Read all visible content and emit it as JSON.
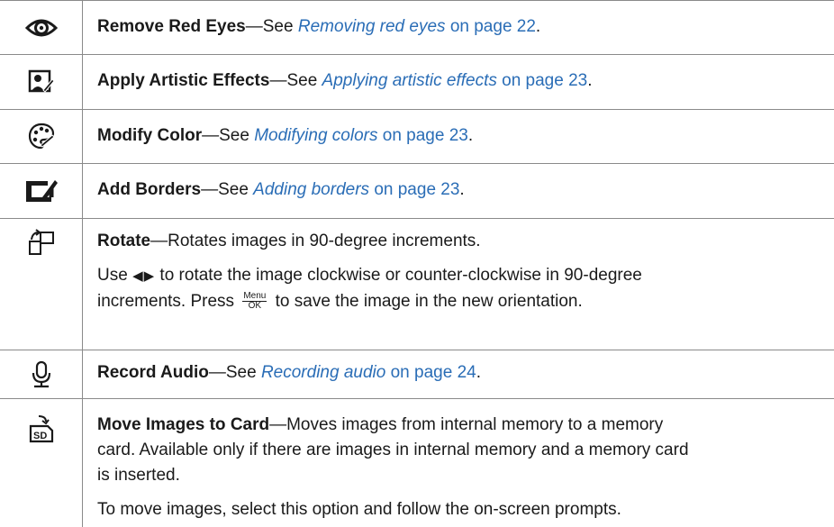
{
  "rows": [
    {
      "icon": "eye-icon",
      "title": "Remove Red Eyes",
      "dash": "—See ",
      "link": "Removing red eyes",
      "on": " on page 22",
      "end": "."
    },
    {
      "icon": "artistic-effects-icon",
      "title": "Apply Artistic Effects",
      "dash": "—See ",
      "link": "Applying artistic effects",
      "on": " on page 23",
      "end": "."
    },
    {
      "icon": "palette-icon",
      "title": "Modify Color",
      "dash": "—See ",
      "link": "Modifying colors",
      "on": " on page 23",
      "end": "."
    },
    {
      "icon": "border-icon",
      "title": "Add Borders",
      "dash": "—See ",
      "link": "Adding borders",
      "on": " on page 23",
      "end": "."
    },
    {
      "icon": "rotate-icon",
      "title": "Rotate",
      "desc": "—Rotates images in 90-degree increments.",
      "p2a": "Use ",
      "p2arrows": "◀▶",
      "p2b": " to rotate the image clockwise or counter-clockwise in 90-degree",
      "p2c": "increments. Press ",
      "menu_top": "Menu",
      "menu_bottom": "OK",
      "p2d": " to save the image in the new orientation."
    },
    {
      "icon": "microphone-icon",
      "title": "Record Audio",
      "dash": "—See ",
      "link": "Recording audio",
      "on": " on page 24",
      "end": "."
    },
    {
      "icon": "move-to-card-icon",
      "title": "Move Images to Card",
      "desc1": "—Moves images from internal memory to a memory",
      "desc2": "card. Available only if there are images in internal memory and a memory card",
      "desc3": "is inserted.",
      "p2": "To move images, select this option and follow the on-screen prompts."
    }
  ],
  "colors": {
    "link": "#2a6db6",
    "rule": "#8a8a8a",
    "text": "#1a1a1a"
  }
}
